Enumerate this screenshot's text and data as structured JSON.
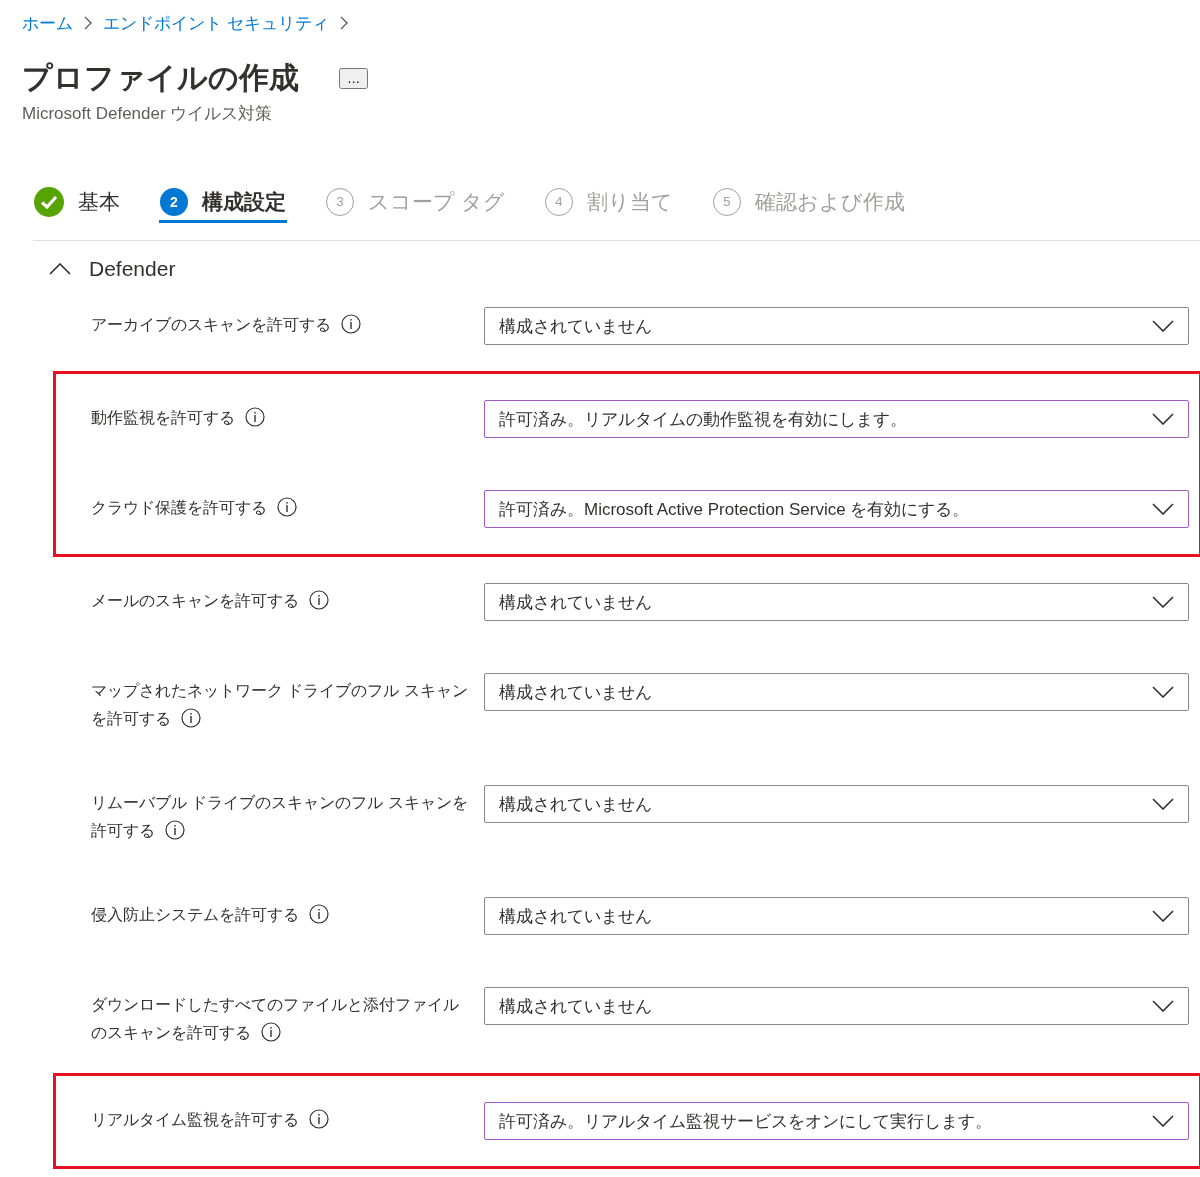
{
  "breadcrumb": [
    {
      "label": "ホーム"
    },
    {
      "label": "エンドポイント セキュリティ"
    }
  ],
  "title": "プロファイルの作成",
  "more_button": "…",
  "subtitle": "Microsoft Defender ウイルス対策",
  "steps": [
    {
      "kind": "complete",
      "label": "基本",
      "selected": false
    },
    {
      "kind": "current",
      "number": "2",
      "label": "構成設定",
      "selected": true
    },
    {
      "kind": "pending",
      "number": "3",
      "label": "スコープ タグ",
      "selected": false
    },
    {
      "kind": "pending",
      "number": "4",
      "label": "割り当て",
      "selected": false
    },
    {
      "kind": "pending",
      "number": "5",
      "label": "確認および作成",
      "selected": false
    }
  ],
  "section": {
    "title": "Defender",
    "expanded": true,
    "settings": [
      {
        "label": "アーカイブのスキャンを許可する",
        "value": "構成されていません",
        "configured": false,
        "highlighted": false
      },
      {
        "label": "動作監視を許可する",
        "value": "許可済み。リアルタイムの動作監視を有効にします。",
        "configured": true,
        "highlighted": true
      },
      {
        "label": "クラウド保護を許可する",
        "value": "許可済み。Microsoft Active Protection Service を有効にする。",
        "configured": true,
        "highlighted": true
      },
      {
        "label": "メールのスキャンを許可する",
        "value": "構成されていません",
        "configured": false,
        "highlighted": false
      },
      {
        "label": "マップされたネットワーク ドライブのフル スキャンを許可する",
        "value": "構成されていません",
        "configured": false,
        "highlighted": false
      },
      {
        "label": "リムーバブル ドライブのスキャンのフル スキャンを許可する",
        "value": "構成されていません",
        "configured": false,
        "highlighted": false
      },
      {
        "label": "侵入防止システムを許可する",
        "value": "構成されていません",
        "configured": false,
        "highlighted": false
      },
      {
        "label": "ダウンロードしたすべてのファイルと添付ファイルのスキャンを許可する",
        "value": "構成されていません",
        "configured": false,
        "highlighted": false
      },
      {
        "label": "リアルタイム監視を許可する",
        "value": "許可済み。リアルタイム監視サービスをオンにして実行します。",
        "configured": true,
        "highlighted": true
      }
    ]
  }
}
